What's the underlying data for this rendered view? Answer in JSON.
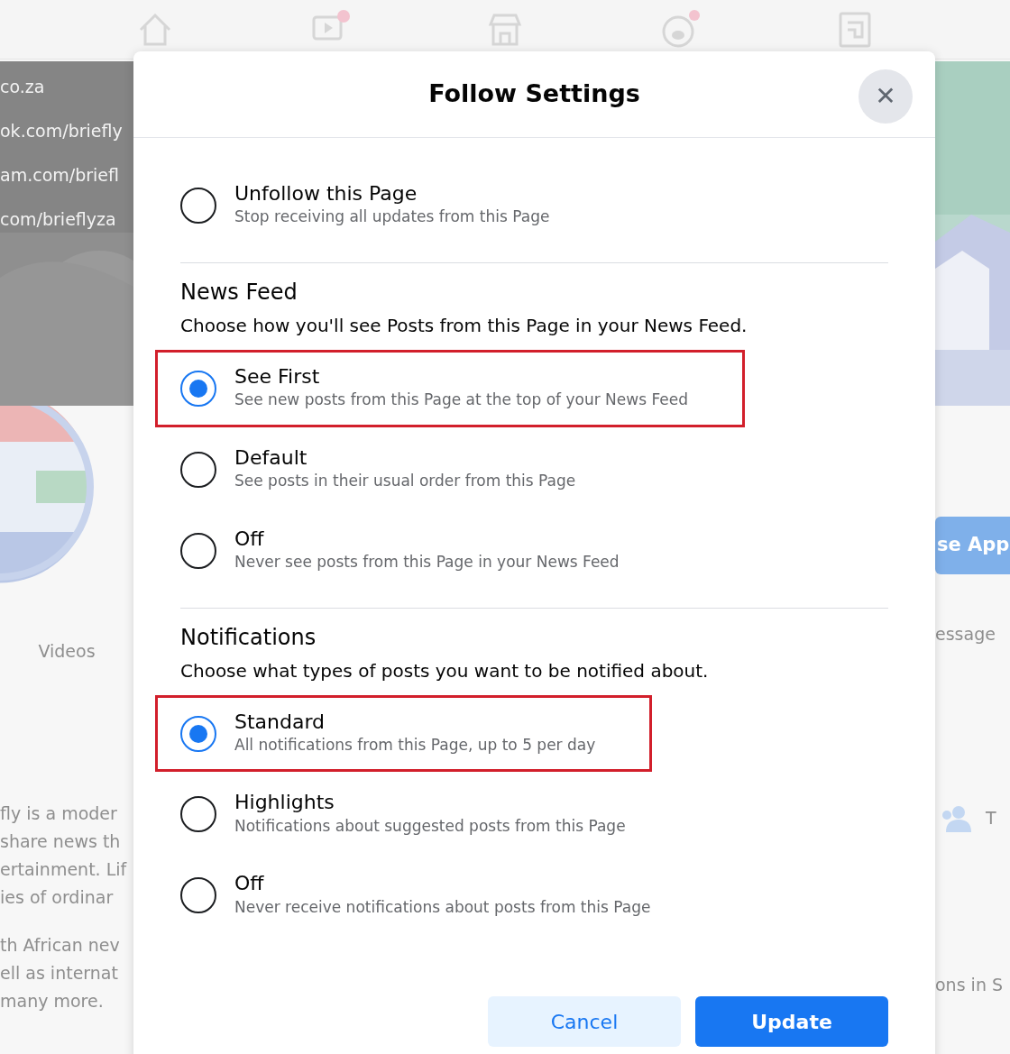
{
  "background": {
    "cover_links": [
      "co.za",
      "ok.com/briefly",
      "am.com/briefl",
      "com/brieflyza"
    ],
    "left_tab": "Videos",
    "about_paragraphs": [
      [
        "fly is a moder",
        "share news th",
        "ertainment. Lif",
        "ies of ordinar"
      ],
      [
        "th African nev",
        "ell as internat",
        "many more."
      ]
    ],
    "right_button": "se App",
    "right_tab": "essage",
    "right_info": "T",
    "right_footer": "ons in S"
  },
  "modal": {
    "title": "Follow Settings",
    "close": "✕",
    "sections": [
      {
        "options": [
          {
            "label": "Unfollow this Page",
            "description": "Stop receiving all updates from this Page",
            "selected": false,
            "highlighted": false
          }
        ]
      },
      {
        "heading": "News Feed",
        "subheading": "Choose how you'll see Posts from this Page in your News Feed.",
        "options": [
          {
            "label": "See First",
            "description": "See new posts from this Page at the top of your News Feed",
            "selected": true,
            "highlighted": true
          },
          {
            "label": "Default",
            "description": "See posts in their usual order from this Page",
            "selected": false,
            "highlighted": false
          },
          {
            "label": "Off",
            "description": "Never see posts from this Page in your News Feed",
            "selected": false,
            "highlighted": false
          }
        ]
      },
      {
        "heading": "Notifications",
        "subheading": "Choose what types of posts you want to be notified about.",
        "options": [
          {
            "label": "Standard",
            "description": "All notifications from this Page, up to 5 per day",
            "selected": true,
            "highlighted": true
          },
          {
            "label": "Highlights",
            "description": "Notifications about suggested posts from this Page",
            "selected": false,
            "highlighted": false
          },
          {
            "label": "Off",
            "description": "Never receive notifications about posts from this Page",
            "selected": false,
            "highlighted": false
          }
        ]
      }
    ],
    "buttons": [
      {
        "label": "Cancel",
        "kind": "secondary"
      },
      {
        "label": "Update",
        "kind": "primary"
      }
    ]
  }
}
